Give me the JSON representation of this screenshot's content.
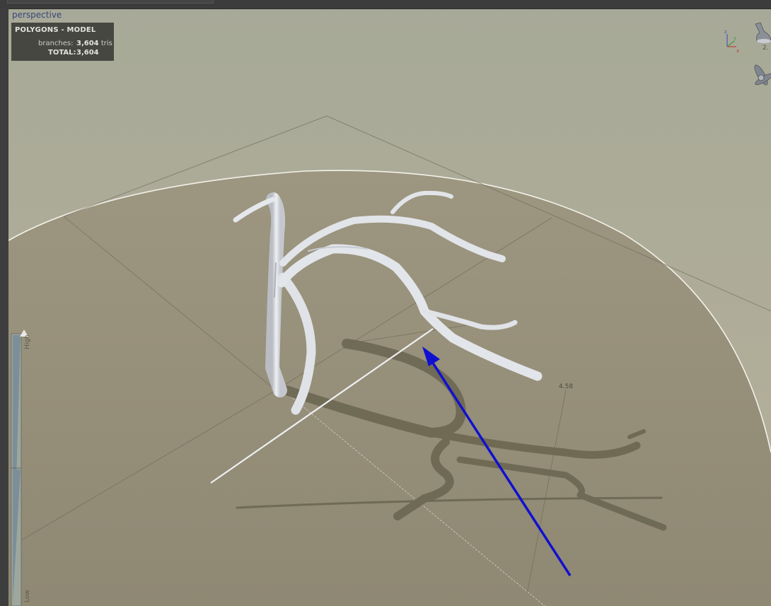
{
  "viewport": {
    "name": "perspective"
  },
  "stats": {
    "title": "POLYGONS - MODEL",
    "branches_label": "branches:",
    "branches_value": "3,604",
    "branches_unit": "tris",
    "total_label": "TOTAL:",
    "total_value": "3,604"
  },
  "lod_slider": {
    "high_label": "High",
    "low_label": "Low"
  },
  "dimension": {
    "value": "4.58"
  },
  "gizmo": {
    "value": "2."
  },
  "colors": {
    "sky_top": "#a9ab9b",
    "sky_bottom": "#b3ae98",
    "ground": "#958e78",
    "branch": "#dfe2e6",
    "shadow": "#6a6550",
    "arrow": "#1010d0",
    "label_persp": "#37477a"
  },
  "icons": [
    "axis-gizmo-icon",
    "spotlight-icon",
    "wind-fan-icon",
    "annotation-arrow-icon"
  ]
}
